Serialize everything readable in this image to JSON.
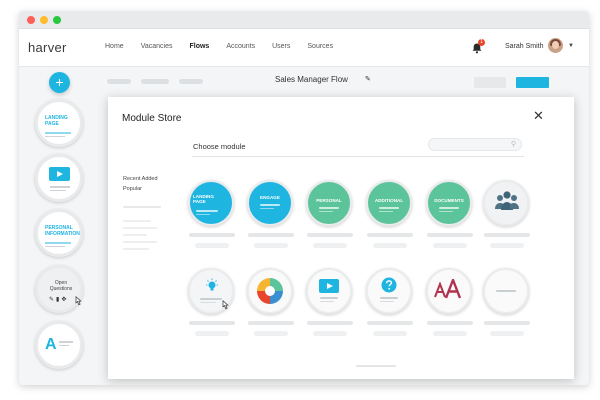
{
  "nav": {
    "logo": "harver",
    "links": [
      "Home",
      "Vacancies",
      "Flows",
      "Accounts",
      "Users",
      "Sources"
    ],
    "active": "Flows",
    "notification_count": "1",
    "user_name": "Sarah Smith"
  },
  "sidebar": {
    "add_label": "+",
    "cards": [
      {
        "label": "Landing Page"
      },
      {
        "label": ""
      },
      {
        "label": "Personal Information"
      },
      {
        "label": "Open Questions"
      },
      {
        "label": "A"
      }
    ]
  },
  "flow": {
    "title": "Sales Manager Flow"
  },
  "modal": {
    "title": "Module Store",
    "close_glyph": "✕",
    "choose_label": "Choose module",
    "filters": [
      "Recent Added",
      "Popular"
    ],
    "row1": [
      {
        "label": "Landing Page",
        "color": "#1fb5e1"
      },
      {
        "label": "Engage",
        "color": "#1fb5e1"
      },
      {
        "label": "Personal",
        "color": "#5cc49a"
      },
      {
        "label": "Additional",
        "color": "#5cc49a"
      },
      {
        "label": "Documents",
        "color": "#5cc49a"
      },
      {
        "label": "",
        "color": "#f1f2f3"
      }
    ]
  },
  "colors": {
    "accent": "#1fb5e1",
    "green": "#5cc49a",
    "danger": "#e8452c"
  },
  "icons": [
    "bell-icon",
    "avatar",
    "pencil-icon",
    "close-icon",
    "search-icon",
    "people-icon",
    "lightbulb-icon",
    "pie-icon",
    "video-icon",
    "question-icon",
    "typography-icon",
    "cursor-icon",
    "edit-icon",
    "trash-icon",
    "move-icon"
  ]
}
